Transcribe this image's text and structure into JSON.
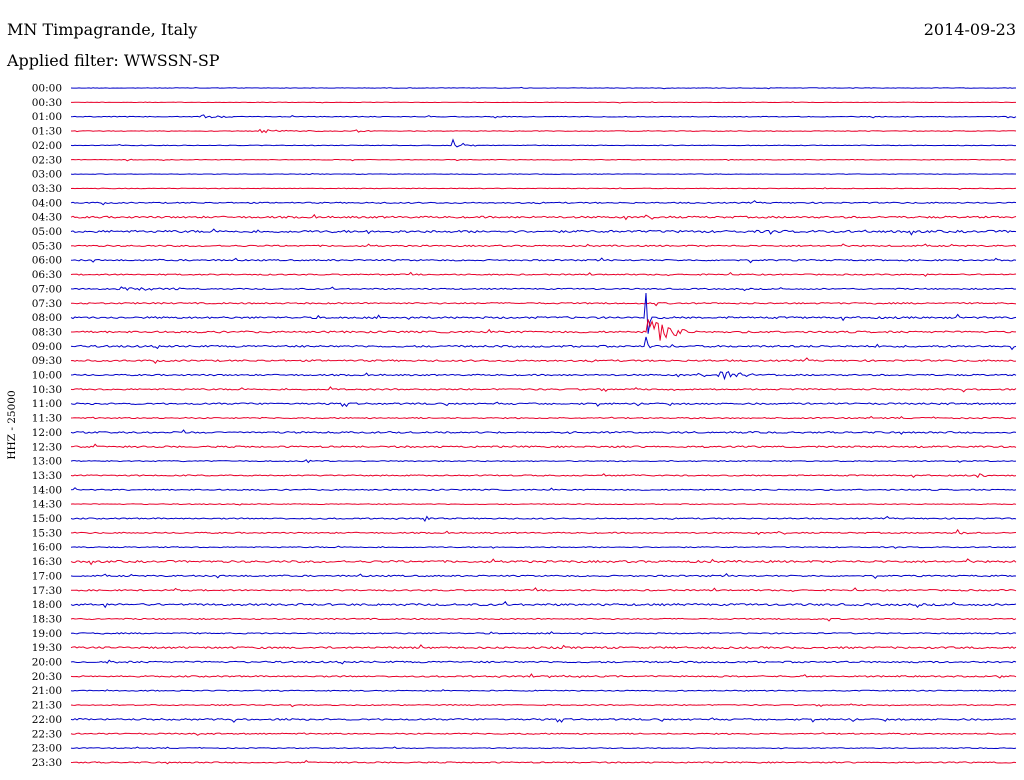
{
  "header": {
    "station": "MN Timpagrande, Italy",
    "date": "2014-09-23",
    "filter": "Applied filter: WWSSN-SP"
  },
  "chart_data": {
    "type": "line",
    "title": "MN Timpagrande, Italy",
    "ylabel": "HHZ - 25000",
    "colors": {
      "even": "#0000c8",
      "odd": "#e8002a"
    },
    "rows": [
      {
        "label": "00:00",
        "noise": 0.25,
        "events": [
          {
            "t": 0.45,
            "amp": 1.2,
            "dur": 0.01
          }
        ]
      },
      {
        "label": "00:30",
        "noise": 0.2,
        "events": []
      },
      {
        "label": "01:00",
        "noise": 0.35,
        "events": [
          {
            "t": 0.14,
            "amp": 2.0,
            "dur": 0.04
          }
        ]
      },
      {
        "label": "01:30",
        "noise": 0.35,
        "events": [
          {
            "t": 0.2,
            "amp": 1.5,
            "dur": 0.07
          },
          {
            "t": 0.3,
            "amp": 1.5,
            "dur": 0.03
          }
        ]
      },
      {
        "label": "02:00",
        "noise": 0.3,
        "events": [
          {
            "t": 0.405,
            "amp": 6,
            "dur": 0.025
          }
        ]
      },
      {
        "label": "02:30",
        "noise": 0.3,
        "events": [
          {
            "t": 0.06,
            "amp": 2,
            "dur": 0.008
          }
        ]
      },
      {
        "label": "03:00",
        "noise": 0.25,
        "events": []
      },
      {
        "label": "03:30",
        "noise": 0.3,
        "events": []
      },
      {
        "label": "04:00",
        "noise": 0.6,
        "events": []
      },
      {
        "label": "04:30",
        "noise": 0.9,
        "events": []
      },
      {
        "label": "05:00",
        "noise": 1.1,
        "events": []
      },
      {
        "label": "05:30",
        "noise": 0.7,
        "events": []
      },
      {
        "label": "06:00",
        "noise": 0.7,
        "events": []
      },
      {
        "label": "06:30",
        "noise": 0.6,
        "events": []
      },
      {
        "label": "07:00",
        "noise": 0.6,
        "events": [
          {
            "t": 0.05,
            "amp": 2.2,
            "dur": 0.1
          }
        ]
      },
      {
        "label": "07:30",
        "noise": 0.7,
        "events": []
      },
      {
        "label": "08:00",
        "noise": 0.9,
        "events": [
          {
            "t": 0.61,
            "amp": 32,
            "dur": 0.003
          }
        ]
      },
      {
        "label": "08:30",
        "noise": 0.9,
        "events": [
          {
            "t": 0.612,
            "amp": 16,
            "dur": 0.04
          }
        ]
      },
      {
        "label": "09:00",
        "noise": 0.9,
        "events": [
          {
            "t": 0.61,
            "amp": 14,
            "dur": 0.004
          }
        ]
      },
      {
        "label": "09:30",
        "noise": 0.8,
        "events": []
      },
      {
        "label": "10:00",
        "noise": 0.7,
        "events": [
          {
            "t": 0.685,
            "amp": 5,
            "dur": 0.05
          }
        ]
      },
      {
        "label": "10:30",
        "noise": 0.7,
        "events": [
          {
            "t": 0.275,
            "amp": 3,
            "dur": 0.005
          }
        ]
      },
      {
        "label": "11:00",
        "noise": 0.8,
        "events": []
      },
      {
        "label": "11:30",
        "noise": 0.6,
        "events": []
      },
      {
        "label": "12:00",
        "noise": 0.8,
        "events": []
      },
      {
        "label": "12:30",
        "noise": 0.8,
        "events": []
      },
      {
        "label": "13:00",
        "noise": 0.5,
        "events": [
          {
            "t": 0.25,
            "amp": 2,
            "dur": 0.01
          }
        ]
      },
      {
        "label": "13:30",
        "noise": 0.6,
        "events": [
          {
            "t": 0.96,
            "amp": 2.5,
            "dur": 0.015
          }
        ]
      },
      {
        "label": "14:00",
        "noise": 0.6,
        "events": []
      },
      {
        "label": "14:30",
        "noise": 0.4,
        "events": []
      },
      {
        "label": "15:00",
        "noise": 0.6,
        "events": [
          {
            "t": 0.375,
            "amp": 3,
            "dur": 0.01
          }
        ]
      },
      {
        "label": "15:30",
        "noise": 0.6,
        "events": [
          {
            "t": 0.94,
            "amp": 3,
            "dur": 0.015
          }
        ]
      },
      {
        "label": "16:00",
        "noise": 0.5,
        "events": []
      },
      {
        "label": "16:30",
        "noise": 1.0,
        "events": []
      },
      {
        "label": "17:00",
        "noise": 0.7,
        "events": []
      },
      {
        "label": "17:30",
        "noise": 0.7,
        "events": []
      },
      {
        "label": "18:00",
        "noise": 1.0,
        "events": []
      },
      {
        "label": "18:30",
        "noise": 0.6,
        "events": []
      },
      {
        "label": "19:00",
        "noise": 0.6,
        "events": []
      },
      {
        "label": "19:30",
        "noise": 0.9,
        "events": []
      },
      {
        "label": "20:00",
        "noise": 0.8,
        "events": [
          {
            "t": 0.04,
            "amp": 2,
            "dur": 0.02
          }
        ]
      },
      {
        "label": "20:30",
        "noise": 0.7,
        "events": []
      },
      {
        "label": "21:00",
        "noise": 0.5,
        "events": []
      },
      {
        "label": "21:30",
        "noise": 0.5,
        "events": []
      },
      {
        "label": "22:00",
        "noise": 0.8,
        "events": []
      },
      {
        "label": "22:30",
        "noise": 0.6,
        "events": [
          {
            "t": 0.135,
            "amp": 2.5,
            "dur": 0.007
          }
        ]
      },
      {
        "label": "23:00",
        "noise": 0.4,
        "events": []
      },
      {
        "label": "23:30",
        "noise": 0.6,
        "events": []
      }
    ]
  }
}
